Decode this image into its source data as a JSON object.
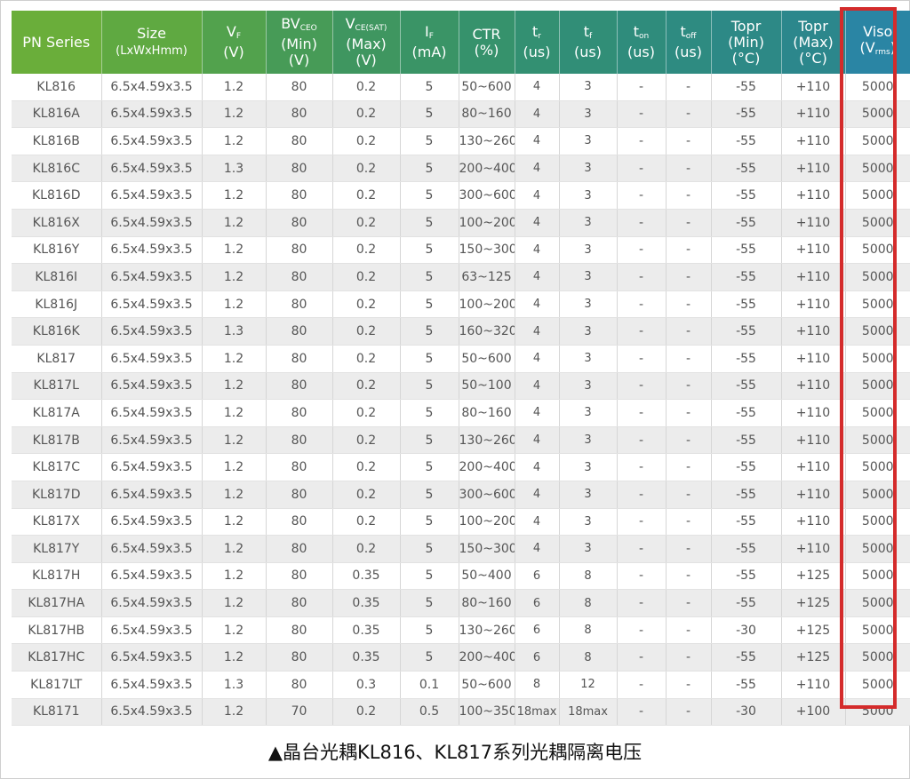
{
  "table": {
    "headers": [
      {
        "main": "PN Series"
      },
      {
        "main": "Size",
        "line2": "(LxWxHmm)"
      },
      {
        "main": "V",
        "sub": "F",
        "line2": "(V)"
      },
      {
        "main": "BV",
        "sub": "CEO",
        "line2": "(Min)",
        "line3": "(V)"
      },
      {
        "main": "V",
        "sub": "CE(SAT)",
        "line2": "(Max)",
        "line3": "(V)"
      },
      {
        "main": "I",
        "sub": "F",
        "line2": "(mA)"
      },
      {
        "main": "CTR",
        "line2": "(%)"
      },
      {
        "main": "t",
        "sub": "r",
        "line2": "(us)"
      },
      {
        "main": "t",
        "sub": "f",
        "line2": "(us)"
      },
      {
        "main": "t",
        "sub": "on",
        "line2": "(us)"
      },
      {
        "main": "t",
        "sub": "off",
        "line2": "(us)"
      },
      {
        "main": "Topr",
        "line2": "(Min)",
        "line3": "(°C)"
      },
      {
        "main": "Topr",
        "line2": "(Max)",
        "line3": "(°C)"
      },
      {
        "main": "Viso",
        "line2": "(V",
        "sub2": "rms",
        "line2end": ")"
      }
    ],
    "header_colors": [
      "#6aae3a",
      "#5fa941",
      "#52a24d",
      "#479b57",
      "#3f9660",
      "#3a9466",
      "#36926c",
      "#339072",
      "#318e77",
      "#2f8c7c",
      "#2e8b81",
      "#2d8986",
      "#2c878c",
      "#2a85a4"
    ],
    "rows": [
      [
        "KL816",
        "6.5x4.59x3.5",
        "1.2",
        "80",
        "0.2",
        "5",
        "50~600",
        "4",
        "3",
        "-",
        "-",
        "-55",
        "+110",
        "5000"
      ],
      [
        "KL816A",
        "6.5x4.59x3.5",
        "1.2",
        "80",
        "0.2",
        "5",
        "80~160",
        "4",
        "3",
        "-",
        "-",
        "-55",
        "+110",
        "5000"
      ],
      [
        "KL816B",
        "6.5x4.59x3.5",
        "1.2",
        "80",
        "0.2",
        "5",
        "130~260",
        "4",
        "3",
        "-",
        "-",
        "-55",
        "+110",
        "5000"
      ],
      [
        "KL816C",
        "6.5x4.59x3.5",
        "1.3",
        "80",
        "0.2",
        "5",
        "200~400",
        "4",
        "3",
        "-",
        "-",
        "-55",
        "+110",
        "5000"
      ],
      [
        "KL816D",
        "6.5x4.59x3.5",
        "1.2",
        "80",
        "0.2",
        "5",
        "300~600",
        "4",
        "3",
        "-",
        "-",
        "-55",
        "+110",
        "5000"
      ],
      [
        "KL816X",
        "6.5x4.59x3.5",
        "1.2",
        "80",
        "0.2",
        "5",
        "100~200",
        "4",
        "3",
        "-",
        "-",
        "-55",
        "+110",
        "5000"
      ],
      [
        "KL816Y",
        "6.5x4.59x3.5",
        "1.2",
        "80",
        "0.2",
        "5",
        "150~300",
        "4",
        "3",
        "-",
        "-",
        "-55",
        "+110",
        "5000"
      ],
      [
        "KL816I",
        "6.5x4.59x3.5",
        "1.2",
        "80",
        "0.2",
        "5",
        "63~125",
        "4",
        "3",
        "-",
        "-",
        "-55",
        "+110",
        "5000"
      ],
      [
        "KL816J",
        "6.5x4.59x3.5",
        "1.2",
        "80",
        "0.2",
        "5",
        "100~200",
        "4",
        "3",
        "-",
        "-",
        "-55",
        "+110",
        "5000"
      ],
      [
        "KL816K",
        "6.5x4.59x3.5",
        "1.3",
        "80",
        "0.2",
        "5",
        "160~320",
        "4",
        "3",
        "-",
        "-",
        "-55",
        "+110",
        "5000"
      ],
      [
        "KL817",
        "6.5x4.59x3.5",
        "1.2",
        "80",
        "0.2",
        "5",
        "50~600",
        "4",
        "3",
        "-",
        "-",
        "-55",
        "+110",
        "5000"
      ],
      [
        "KL817L",
        "6.5x4.59x3.5",
        "1.2",
        "80",
        "0.2",
        "5",
        "50~100",
        "4",
        "3",
        "-",
        "-",
        "-55",
        "+110",
        "5000"
      ],
      [
        "KL817A",
        "6.5x4.59x3.5",
        "1.2",
        "80",
        "0.2",
        "5",
        "80~160",
        "4",
        "3",
        "-",
        "-",
        "-55",
        "+110",
        "5000"
      ],
      [
        "KL817B",
        "6.5x4.59x3.5",
        "1.2",
        "80",
        "0.2",
        "5",
        "130~260",
        "4",
        "3",
        "-",
        "-",
        "-55",
        "+110",
        "5000"
      ],
      [
        "KL817C",
        "6.5x4.59x3.5",
        "1.2",
        "80",
        "0.2",
        "5",
        "200~400",
        "4",
        "3",
        "-",
        "-",
        "-55",
        "+110",
        "5000"
      ],
      [
        "KL817D",
        "6.5x4.59x3.5",
        "1.2",
        "80",
        "0.2",
        "5",
        "300~600",
        "4",
        "3",
        "-",
        "-",
        "-55",
        "+110",
        "5000"
      ],
      [
        "KL817X",
        "6.5x4.59x3.5",
        "1.2",
        "80",
        "0.2",
        "5",
        "100~200",
        "4",
        "3",
        "-",
        "-",
        "-55",
        "+110",
        "5000"
      ],
      [
        "KL817Y",
        "6.5x4.59x3.5",
        "1.2",
        "80",
        "0.2",
        "5",
        "150~300",
        "4",
        "3",
        "-",
        "-",
        "-55",
        "+110",
        "5000"
      ],
      [
        "KL817H",
        "6.5x4.59x3.5",
        "1.2",
        "80",
        "0.35",
        "5",
        "50~400",
        "6",
        "8",
        "-",
        "-",
        "-55",
        "+125",
        "5000"
      ],
      [
        "KL817HA",
        "6.5x4.59x3.5",
        "1.2",
        "80",
        "0.35",
        "5",
        "80~160",
        "6",
        "8",
        "-",
        "-",
        "-55",
        "+125",
        "5000"
      ],
      [
        "KL817HB",
        "6.5x4.59x3.5",
        "1.2",
        "80",
        "0.35",
        "5",
        "130~260",
        "6",
        "8",
        "-",
        "-",
        "-30",
        "+125",
        "5000"
      ],
      [
        "KL817HC",
        "6.5x4.59x3.5",
        "1.2",
        "80",
        "0.35",
        "5",
        "200~400",
        "6",
        "8",
        "-",
        "-",
        "-55",
        "+125",
        "5000"
      ],
      [
        "KL817LT",
        "6.5x4.59x3.5",
        "1.3",
        "80",
        "0.3",
        "0.1",
        "50~600",
        "8",
        "12",
        "-",
        "-",
        "-55",
        "+110",
        "5000"
      ],
      [
        "KL8171",
        "6.5x4.59x3.5",
        "1.2",
        "70",
        "0.2",
        "0.5",
        "100~350",
        "18max",
        "18max",
        "-",
        "-",
        "-30",
        "+100",
        "5000"
      ]
    ]
  },
  "highlight_color": "#d42b2b",
  "caption": "▲晶台光耦KL816、KL817系列光耦隔离电压"
}
